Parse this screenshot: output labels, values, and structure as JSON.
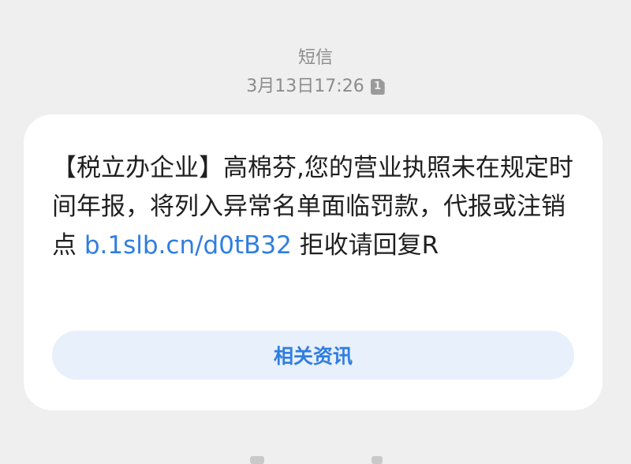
{
  "header": {
    "sender": "短信",
    "timestamp": "3月13日17:26",
    "sim_badge": "1"
  },
  "message": {
    "prefix": "【税立办企业】高棉芬,您的营业执照未在规定时间年报，将列入异常名单面临罚款，代报或注销点",
    "link": "b.1slb.cn/d0tB32",
    "suffix": "拒收请回复R"
  },
  "related_button": {
    "label": "相关资讯"
  },
  "colors": {
    "link": "#2f7de1",
    "button_bg": "#e7f0fb",
    "page_bg": "#efefef"
  }
}
